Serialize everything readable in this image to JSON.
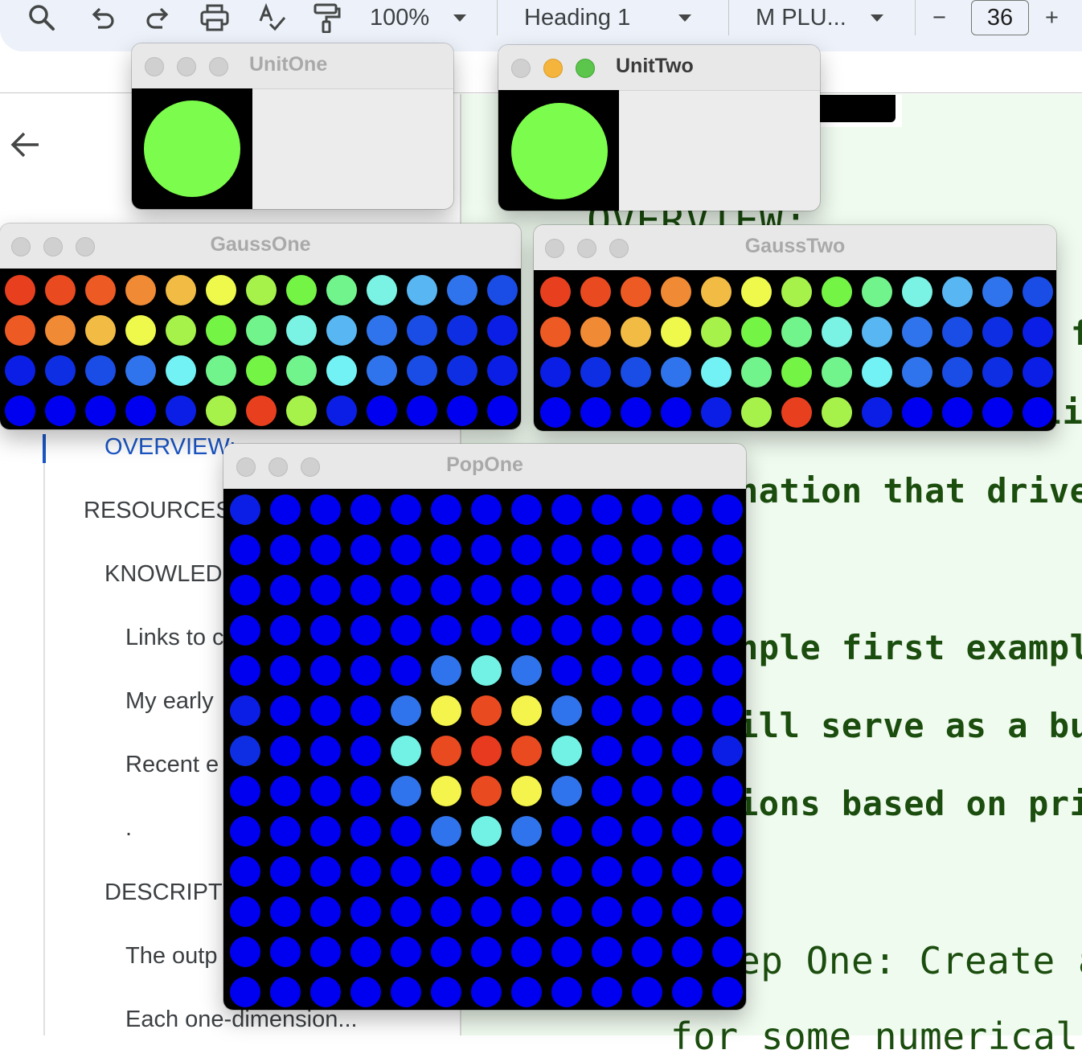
{
  "toolbar": {
    "zoom": "100%",
    "style": "Heading 1",
    "font": "M PLU...",
    "font_size": "36",
    "minus": "−",
    "plus": "+"
  },
  "outline": {
    "items": [
      {
        "label": "OVERVIEW:",
        "active": true
      },
      {
        "label": "RESOURCES"
      },
      {
        "label": "KNOWLED"
      },
      {
        "label": "Links to c"
      },
      {
        "label": "My early"
      },
      {
        "label": "Recent e"
      },
      {
        "label": "."
      },
      {
        "label": "DESCRIPTI"
      },
      {
        "label": "The outp"
      },
      {
        "label": "Each one-dimension..."
      }
    ]
  },
  "document": {
    "heading_fragment": "OVERVIEW:",
    "lines": [
      "f",
      "pli",
      "nation that drive",
      "nple first exampl",
      "ill serve as a bu",
      "ions based on pri",
      "ep One: Create a",
      "for some numerical t"
    ]
  },
  "windows": {
    "unit_one": {
      "title": "UnitOne"
    },
    "unit_two": {
      "title": "UnitTwo"
    },
    "gauss_one": {
      "title": "GaussOne"
    },
    "gauss_two": {
      "title": "GaussTwo"
    },
    "pop_one": {
      "title": "PopOne"
    }
  },
  "colors": {
    "green_unit": "#7cfc4c",
    "window_bg": "#ececec",
    "doc_bg": "#f0fbef",
    "doc_text": "#1b4d0e",
    "outline_active": "#1a56c6"
  },
  "grids": {
    "gauss_one": [
      [
        "#e8401f",
        "#ea4a20",
        "#ee5a24",
        "#f08a34",
        "#f2bc44",
        "#eef94c",
        "#a6f24a",
        "#74f444",
        "#72f48c",
        "#7af2e4",
        "#58b6f2",
        "#2f74ec",
        "#1a4ce6"
      ],
      [
        "#ee5a24",
        "#f08a34",
        "#f2bc44",
        "#eef94c",
        "#a6f24a",
        "#74f444",
        "#72f48c",
        "#7af2e4",
        "#58b6f2",
        "#2f74ec",
        "#1a4ce6",
        "#0e2ee4",
        "#0a1ee6"
      ],
      [
        "#0a1ee6",
        "#0e2ee4",
        "#1a4ce6",
        "#2f74ec",
        "#72f2f4",
        "#72f48c",
        "#74f444",
        "#72f48c",
        "#72f2f4",
        "#2f74ec",
        "#1a4ce6",
        "#0e2ee4",
        "#0a1ee6"
      ],
      [
        "#0000f0",
        "#0000f0",
        "#0000f0",
        "#0000f0",
        "#0a1ee6",
        "#a6f24a",
        "#e8401f",
        "#a6f24a",
        "#0a1ee6",
        "#0000f0",
        "#0000f0",
        "#0000f0",
        "#0000f0"
      ]
    ],
    "gauss_two": [
      [
        "#e8401f",
        "#ea4a20",
        "#ee5a24",
        "#f08a34",
        "#f2bc44",
        "#eef94c",
        "#a6f24a",
        "#74f444",
        "#72f48c",
        "#7af2e4",
        "#58b6f2",
        "#2f74ec",
        "#1a4ce6"
      ],
      [
        "#ee5a24",
        "#f08a34",
        "#f2bc44",
        "#eef94c",
        "#a6f24a",
        "#74f444",
        "#72f48c",
        "#7af2e4",
        "#58b6f2",
        "#2f74ec",
        "#1a4ce6",
        "#0e2ee4",
        "#0a1ee6"
      ],
      [
        "#0a1ee6",
        "#0e2ee4",
        "#1a4ce6",
        "#2f74ec",
        "#72f2f4",
        "#72f48c",
        "#74f444",
        "#72f48c",
        "#72f2f4",
        "#2f74ec",
        "#1a4ce6",
        "#0e2ee4",
        "#0a1ee6"
      ],
      [
        "#0000f0",
        "#0000f0",
        "#0000f0",
        "#0000f0",
        "#0a1ee6",
        "#a6f24a",
        "#e8401f",
        "#a6f24a",
        "#0a1ee6",
        "#0000f0",
        "#0000f0",
        "#0000f0",
        "#0000f0"
      ]
    ],
    "pop_one_default": "#0000f0",
    "pop_one_special": [
      {
        "r": 0,
        "c": 0,
        "color": "#0a1ee6"
      },
      {
        "r": 4,
        "c": 5,
        "color": "#2f74ec"
      },
      {
        "r": 4,
        "c": 6,
        "color": "#72f2e4"
      },
      {
        "r": 4,
        "c": 7,
        "color": "#2f74ec"
      },
      {
        "r": 5,
        "c": 0,
        "color": "#0a1ee6"
      },
      {
        "r": 5,
        "c": 4,
        "color": "#2f74ec"
      },
      {
        "r": 5,
        "c": 5,
        "color": "#f4f44c"
      },
      {
        "r": 5,
        "c": 6,
        "color": "#ea4a20"
      },
      {
        "r": 5,
        "c": 7,
        "color": "#f4f44c"
      },
      {
        "r": 5,
        "c": 8,
        "color": "#2f74ec"
      },
      {
        "r": 6,
        "c": 0,
        "color": "#0e2ee4"
      },
      {
        "r": 6,
        "c": 4,
        "color": "#72f2e4"
      },
      {
        "r": 6,
        "c": 5,
        "color": "#ea4a20"
      },
      {
        "r": 6,
        "c": 6,
        "color": "#e83a1e"
      },
      {
        "r": 6,
        "c": 7,
        "color": "#ea4a20"
      },
      {
        "r": 6,
        "c": 8,
        "color": "#72f2e4"
      },
      {
        "r": 6,
        "c": 12,
        "color": "#0a1ee6"
      },
      {
        "r": 7,
        "c": 4,
        "color": "#2f74ec"
      },
      {
        "r": 7,
        "c": 5,
        "color": "#f4f44c"
      },
      {
        "r": 7,
        "c": 6,
        "color": "#ea4a20"
      },
      {
        "r": 7,
        "c": 7,
        "color": "#f4f44c"
      },
      {
        "r": 7,
        "c": 8,
        "color": "#2f74ec"
      },
      {
        "r": 8,
        "c": 5,
        "color": "#2f74ec"
      },
      {
        "r": 8,
        "c": 6,
        "color": "#72f2e4"
      },
      {
        "r": 8,
        "c": 7,
        "color": "#2f74ec"
      }
    ]
  }
}
